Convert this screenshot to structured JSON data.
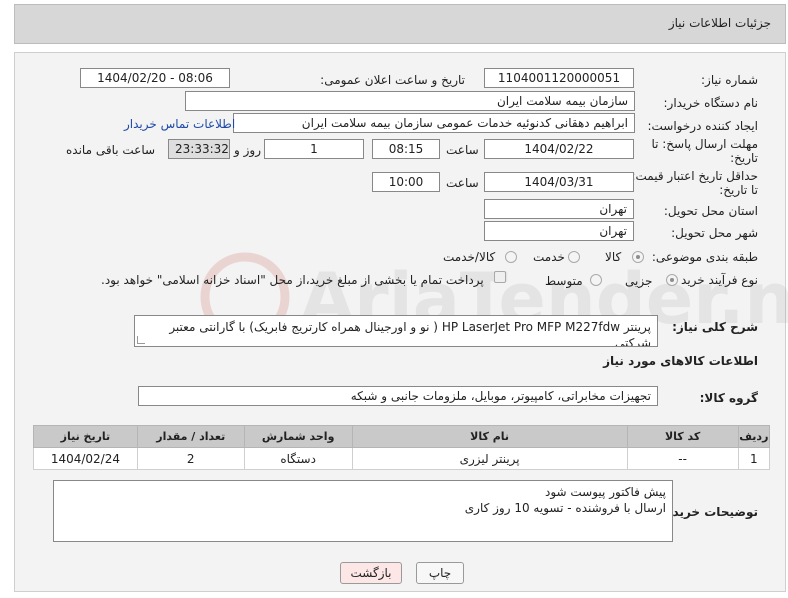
{
  "header": {
    "title": "جزئیات اطلاعات نیاز"
  },
  "fields": {
    "need_number_label": "شماره نیاز:",
    "need_number": "1104001120000051",
    "announce_label": "تاریخ و ساعت اعلان عمومی:",
    "announce_value": "1404/02/20 - 08:06",
    "buyer_org_label": "نام دستگاه خریدار:",
    "buyer_org": "سازمان بیمه سلامت ایران",
    "requester_label": "ایجاد کننده درخواست:",
    "requester": "ابراهیم دهقانی کدنوئیه خدمات عمومی سازمان بیمه سلامت ایران",
    "buyer_contact_link": "اطلاعات تماس خریدار",
    "deadline_label_line1": "مهلت ارسال پاسخ: تا",
    "deadline_label_line2": "تاریخ:",
    "deadline_date": "1404/02/22",
    "time_label": "ساعت",
    "deadline_time": "08:15",
    "days_value": "1",
    "days_label": "روز و",
    "remaining_time": "23:33:32",
    "remaining_label": "ساعت باقی مانده",
    "validity_label_line1": "حداقل تاریخ اعتبار قیمت:",
    "validity_label_line2": "تا تاریخ:",
    "validity_date": "1404/03/31",
    "validity_time": "10:00",
    "province_label": "استان محل تحویل:",
    "province": "تهران",
    "city_label": "شهر محل تحویل:",
    "city": "تهران",
    "category_label": "طبقه بندی موضوعی:",
    "category_options": [
      "کالا",
      "خدمت",
      "کالا/خدمت"
    ],
    "process_label": "نوع فرآیند خرید :",
    "process_options": [
      "جزیی",
      "متوسط"
    ],
    "payment_note": "پرداخت تمام یا بخشی از مبلغ خرید،از محل \"اسناد خزانه اسلامی\" خواهد بود.",
    "description_label": "شرح کلی نیاز:",
    "description": "پرینتر HP LaserJet Pro MFP M227fdw ( نو و اورجینال همراه کارتریج فابریک) با گارانتی معتبر شرکتی",
    "goods_info_title": "اطلاعات کالاهای مورد نیاز",
    "goods_group_label": "گروه کالا:",
    "goods_group": "تجهیزات مخابراتی، کامپیوتر، موبایل، ملزومات جانبی و شبکه",
    "buyer_notes_label": "توضیحات خریدار:",
    "buyer_notes_line1": "پیش فاکتور پیوست شود",
    "buyer_notes_line2": "ارسال با فروشنده - تسویه 10 روز کاری"
  },
  "table": {
    "headers": [
      "ردیف",
      "کد کالا",
      "نام کالا",
      "واحد شمارش",
      "تعداد / مقدار",
      "تاریخ نیاز"
    ],
    "rows": [
      [
        "1",
        "--",
        "پرینتر لیزری",
        "دستگاه",
        "2",
        "1404/02/24"
      ]
    ]
  },
  "buttons": {
    "back": "بازگشت",
    "print": "چاپ"
  },
  "watermark_text": "AriaTender.neT"
}
